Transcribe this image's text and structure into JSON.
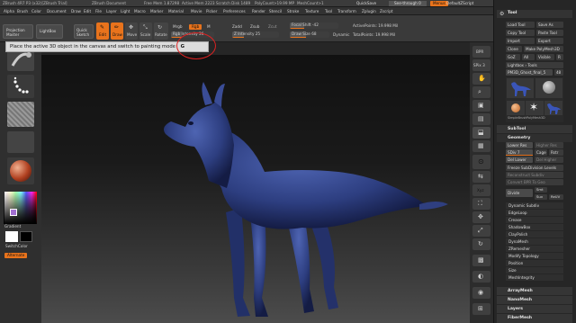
{
  "app": {
    "title": "ZBrush 4R7 P3 (x32)[ZBrush Trial]",
    "document": "ZBrush Document",
    "free_mem": "Free Mem 1.87298",
    "active_mem": "Active Mem 2223",
    "scratch_disk": "Scratch Disk 1489",
    "poly_count": "PolyCount>19.99 MP",
    "mesh_count": "MeshCount>1",
    "quicksave": "QuickSave",
    "see_through": "See-through 0",
    "menus": "Menus",
    "default_script": "DefaultZScript"
  },
  "menubar": {
    "items": [
      "Alpha",
      "Brush",
      "Color",
      "Document",
      "Draw",
      "Edit",
      "File",
      "Layer",
      "Light",
      "Macro",
      "Marker",
      "Material",
      "Movie",
      "Picker",
      "Preferences",
      "Render",
      "Stencil",
      "Stroke",
      "Texture",
      "Tool",
      "Transform",
      "Zplugin",
      "Zscript"
    ]
  },
  "shelf": {
    "projection_master": "Projection Master",
    "lightbox": "LightBox",
    "quick_sketch": "Quick Sketch",
    "edit": "Edit",
    "draw": "Draw",
    "move": "Move",
    "scale": "Scale",
    "rotate": "Rotate",
    "mrgb": "Mrgb",
    "rgb": "Rgb",
    "m": "M",
    "zadd": "Zadd",
    "zsub": "Zsub",
    "zcut": "Zcut",
    "rgb_intensity": "Rgb Intensity 26",
    "z_intensity": "Z Intensity 25",
    "focal_shift": "Focal Shift -42",
    "draw_size": "Draw Size 68",
    "dynamic": "Dynamic",
    "active_points": "ActivePoints: 19.998 Mil",
    "total_points": "TotalPoints: 19.998 Mil"
  },
  "progress": {
    "rgb_intensity": 26,
    "z_intensity": 25,
    "focal_shift": -42,
    "draw_size": 68
  },
  "tooltip": {
    "text": "Place the active 3D object in the canvas and switch to painting mode",
    "hotkey": "G"
  },
  "leftshelf": {
    "gradient_label": "Gradient",
    "switch_color": "SwitchColor",
    "alternate": "Alternate"
  },
  "rightshelf": {
    "buttons": [
      "BPR",
      "SPix 3",
      "Scroll",
      "Zoom",
      "Actual",
      "AAHalf",
      "Dynamic Persp",
      "Floor",
      "Local",
      "L.Sym",
      "Xyz",
      "Frame",
      "Move",
      "Scale",
      "Rotate",
      "PolyF",
      "Transp",
      "Solo",
      "Xpose"
    ]
  },
  "palette": {
    "header": "Tool",
    "load_tool": "Load Tool",
    "save_as": "Save As",
    "copy_tool": "Copy Tool",
    "paste_tool": "Paste Tool",
    "import": "Import",
    "export": "Export",
    "clone": "Clone",
    "make_polymesh": "Make PolyMesh3D",
    "goz": "GoZ",
    "all": "All",
    "visible": "Visible",
    "r": "R",
    "lightbox_tools": "Lightbox › Tools",
    "current_tool": "PM3D_Ghost_final_5",
    "current_tool_value": "48",
    "thumbs": [
      "PM3D_Ghost",
      "Cylinder3D",
      "SimpleBrush",
      "PolyMesh3D",
      "PM3D_Ghost_fnl"
    ],
    "subtool": "SubTool",
    "geometry": "Geometry",
    "lower_res": "Lower Res",
    "higher_res": "Higher Res",
    "sdiv": "SDiv 7",
    "cage": "Cage",
    "rstr": "Rstr",
    "del_lower": "Del Lower",
    "del_higher": "Del Higher",
    "freeze_subdiv": "Freeze SubDivision Levels",
    "reconstruct_subdiv": "Reconstruct Subdiv",
    "convert_bpr": "Convert BPR To Geo",
    "divide": "Divide",
    "smt": "Smt",
    "suv": "Suv",
    "reuv": "ReUV",
    "items": [
      "Dynamic Subdiv",
      "EdgeLoop",
      "Crease",
      "ShadowBox",
      "ClayPolish",
      "DynaMesh",
      "ZRemesher",
      "Modify Topology",
      "Position",
      "Size",
      "MeshIntegrity"
    ],
    "array_mesh": "ArrayMesh",
    "nano_mesh": "NanoMesh",
    "layers": "Layers",
    "fiber_mesh": "FiberMesh"
  },
  "colors": {
    "accent": "#e8731c",
    "model": "#2f3f7a",
    "bg": "#2d2d2d"
  }
}
